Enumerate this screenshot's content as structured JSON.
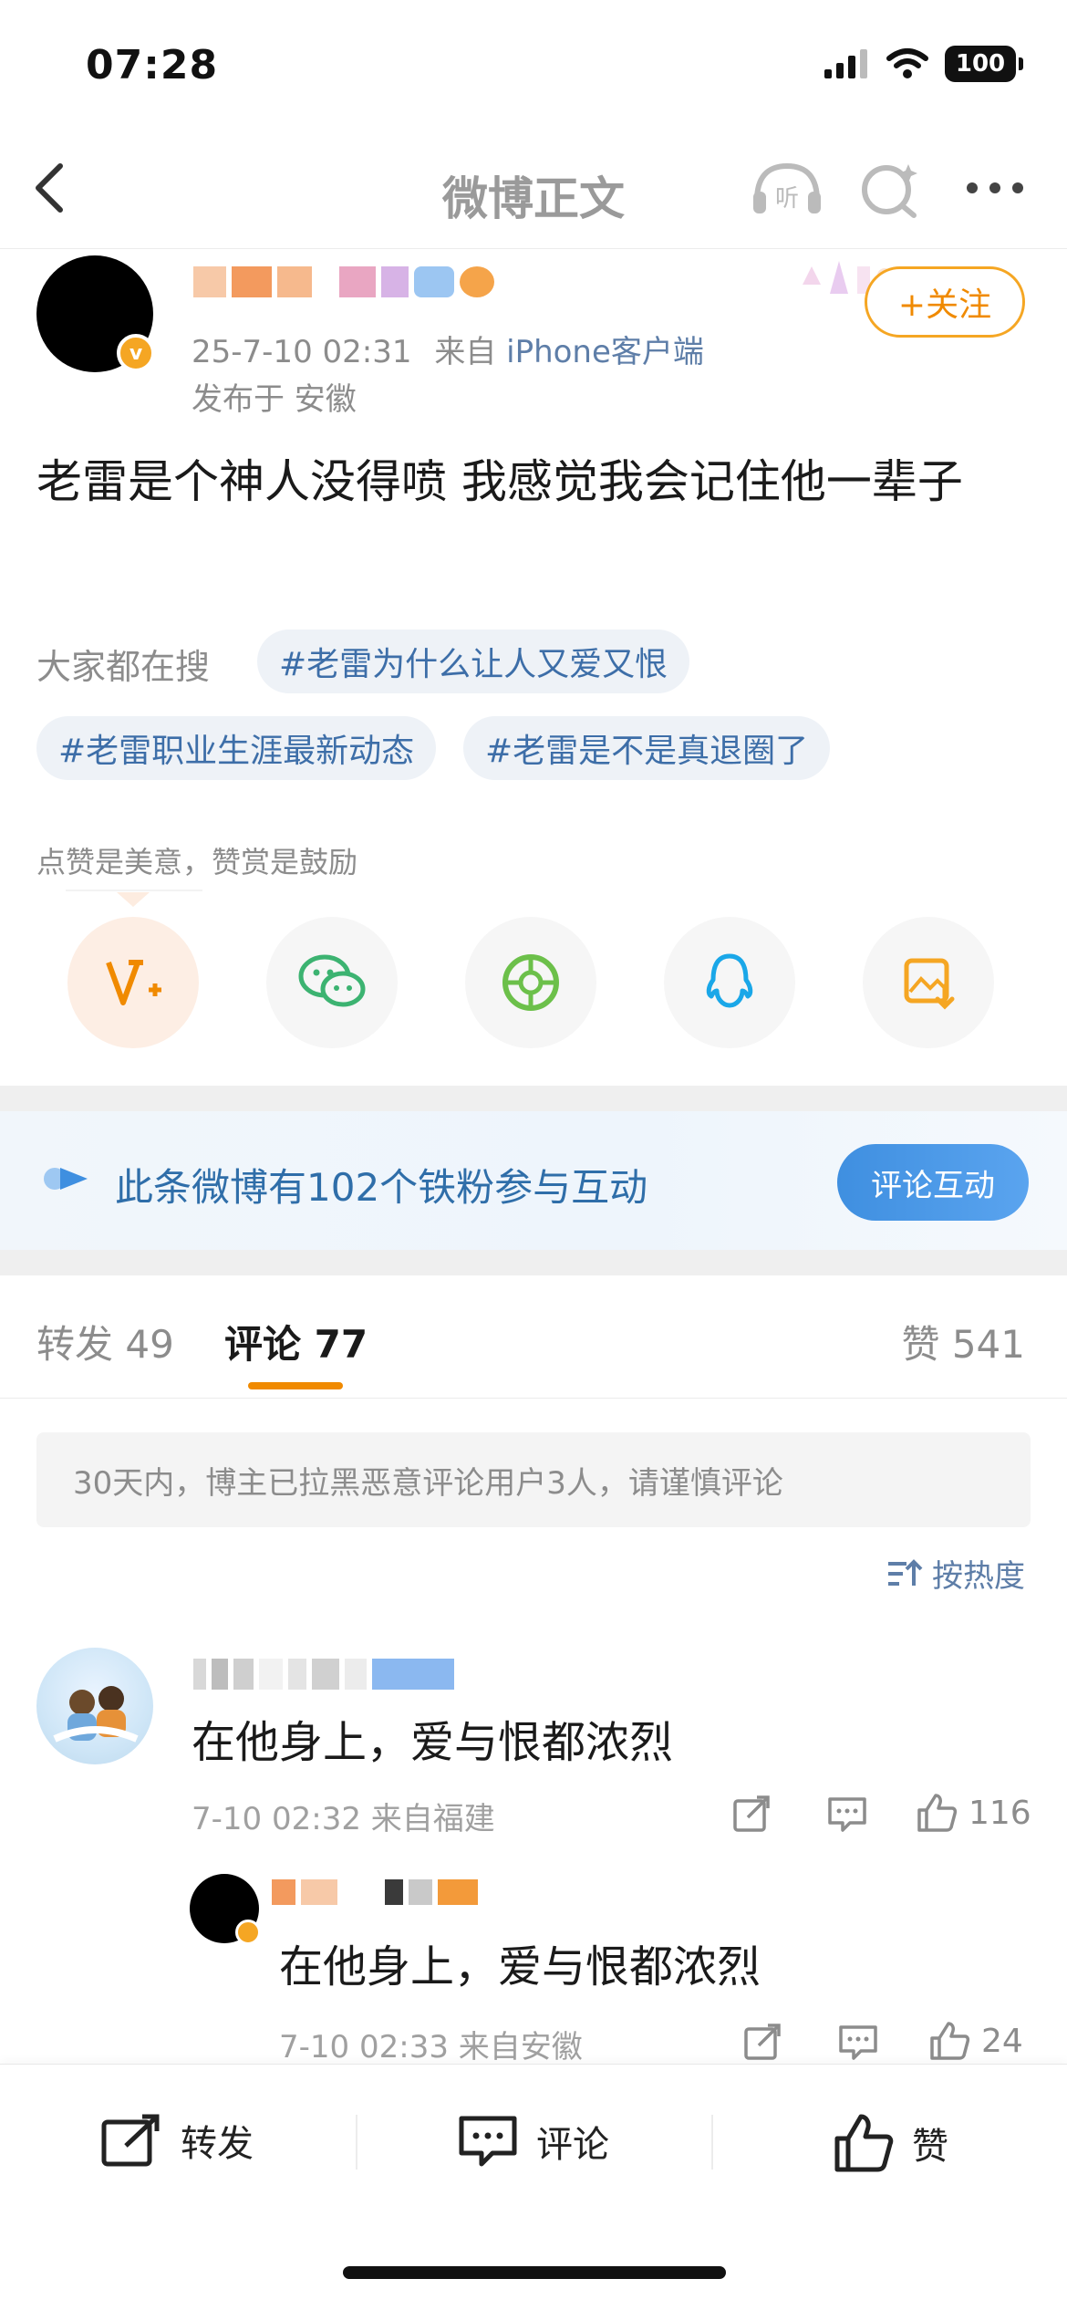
{
  "status_bar": {
    "time": "07:28",
    "battery": "100"
  },
  "nav": {
    "title": "微博正文"
  },
  "post": {
    "meta_time": "25-7-10 02:31",
    "meta_from": "来自",
    "meta_source": "iPhone客户端",
    "location": "发布于 安徽",
    "follow_label": "+关注",
    "text": "老雷是个神人没得喷 我感觉我会记住他一辈子"
  },
  "trending": {
    "label": "大家都在搜",
    "tags": [
      "#老雷为什么让人又爱又恨",
      "#老雷职业生涯最新动态",
      "#老雷是不是真退圈了"
    ]
  },
  "reward_tip": "点赞是美意，赞赏是鼓励",
  "share": [
    "v-plus-icon",
    "wechat-icon",
    "moments-icon",
    "qq-icon",
    "save-image-icon"
  ],
  "fans": {
    "text": "此条微博有102个铁粉参与互动",
    "button": "评论互动"
  },
  "tabs": {
    "repost": "转发 49",
    "comment": "评论 77",
    "like": "赞 541"
  },
  "notice": "30天内，博主已拉黑恶意评论用户3人，请谨慎评论",
  "sort_label": "按热度",
  "comments": [
    {
      "text": "在他身上，爱与恨都浓烈",
      "meta": "7-10 02:32 来自福建",
      "likes": "116",
      "reply": {
        "text": "在他身上，爱与恨都浓烈",
        "meta": "7-10 02:33 来自安徽",
        "likes": "24"
      }
    }
  ],
  "bottom_bar": {
    "repost": "转发",
    "comment": "评论",
    "like": "赞"
  },
  "colors": {
    "accent_orange": "#f08a00",
    "link_blue": "#3d6ea8",
    "verified": "#f5a623"
  }
}
